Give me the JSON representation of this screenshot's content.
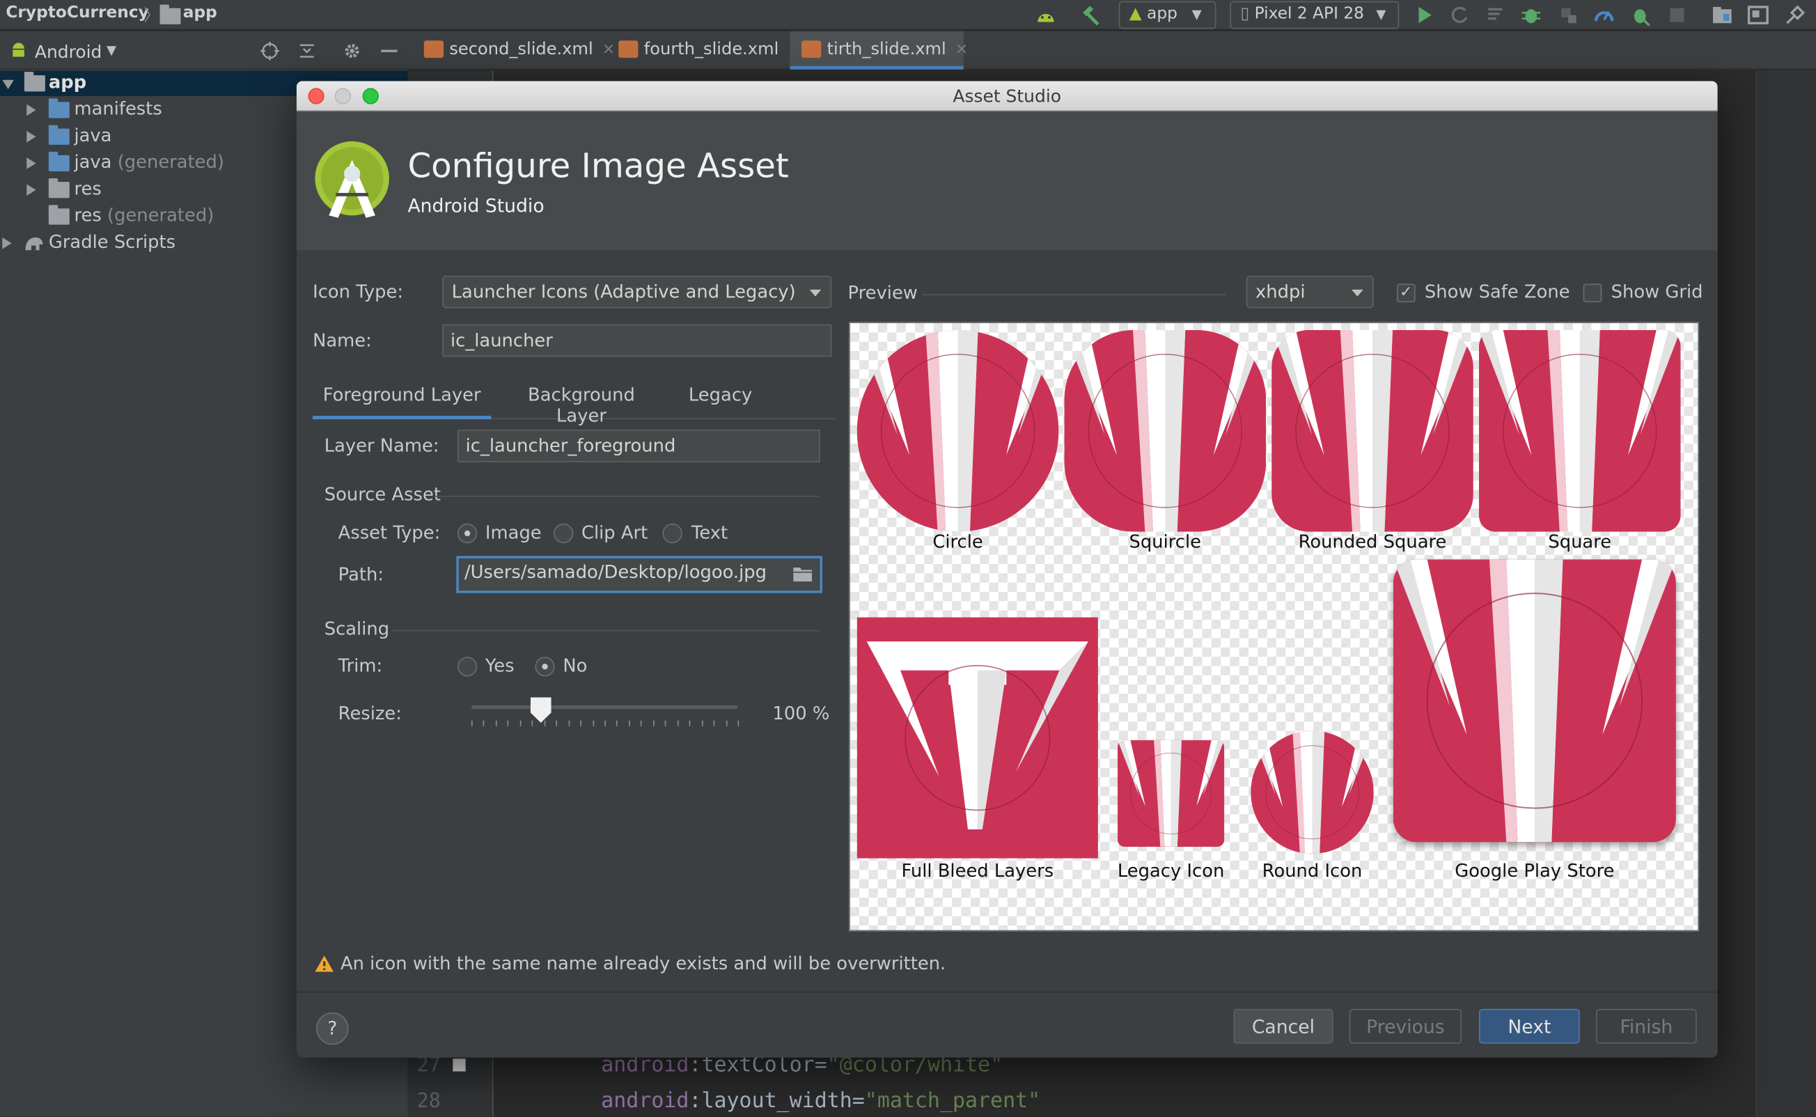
{
  "ide": {
    "project_name": "CryptoCurrency",
    "module_name": "app",
    "run_config": "app",
    "device": "Pixel 2 API 28",
    "project_view": "Android",
    "tree": [
      {
        "label": "app",
        "suffix": ""
      },
      {
        "label": "manifests",
        "suffix": ""
      },
      {
        "label": "java",
        "suffix": ""
      },
      {
        "label": "java",
        "suffix": "(generated)"
      },
      {
        "label": "res",
        "suffix": ""
      },
      {
        "label": "res",
        "suffix": "(generated)"
      },
      {
        "label": "Gradle Scripts",
        "suffix": ""
      }
    ],
    "tabs": [
      {
        "label": "second_slide.xml",
        "close": "✕"
      },
      {
        "label": "fourth_slide.xml",
        "close": "✕"
      },
      {
        "label": "tirth_slide.xml",
        "close": "✕"
      }
    ],
    "code": [
      {
        "line": "27",
        "attr": "android",
        "sep": ":",
        "prop": "textColor",
        "eq": "=",
        "value": "\"@color/white\""
      },
      {
        "line": "28",
        "attr": "android",
        "sep": ":",
        "prop": "layout_width",
        "eq": "=",
        "value": "\"match_parent\""
      }
    ]
  },
  "dialog": {
    "window_title": "Asset Studio",
    "title": "Configure Image Asset",
    "subtitle": "Android Studio",
    "icon_type_label": "Icon Type:",
    "icon_type_value": "Launcher Icons (Adaptive and Legacy)",
    "name_label": "Name:",
    "name_value": "ic_launcher",
    "tabs": [
      "Foreground Layer",
      "Background Layer",
      "Legacy"
    ],
    "layer_name_label": "Layer Name:",
    "layer_name_value": "ic_launcher_foreground",
    "source_asset_label": "Source Asset",
    "asset_type_label": "Asset Type:",
    "asset_types": [
      "Image",
      "Clip Art",
      "Text"
    ],
    "asset_type_selected": "Image",
    "path_label": "Path:",
    "path_value": "/Users/samado/Desktop/logoo.jpg",
    "scaling_label": "Scaling",
    "trim_label": "Trim:",
    "trim_options": [
      "Yes",
      "No"
    ],
    "trim_selected": "No",
    "resize_label": "Resize:",
    "resize_value_text": "100 %",
    "resize_fraction": 0.26,
    "preview_label": "Preview",
    "density_value": "xhdpi",
    "show_safe_zone_label": "Show Safe Zone",
    "show_safe_zone": true,
    "show_grid_label": "Show Grid",
    "show_grid": false,
    "preview_icons": [
      "Circle",
      "Squircle",
      "Rounded Square",
      "Square",
      "Full Bleed Layers",
      "Legacy Icon",
      "Round Icon",
      "Google Play Store"
    ],
    "warning": "An icon with the same name already exists and will be overwritten.",
    "help_label": "?",
    "buttons": {
      "cancel": "Cancel",
      "previous": "Previous",
      "next": "Next",
      "finish": "Finish"
    }
  },
  "colors": {
    "accent": "#4a88c7",
    "icon_red": "#cb3356",
    "android_green": "#a4c639"
  }
}
